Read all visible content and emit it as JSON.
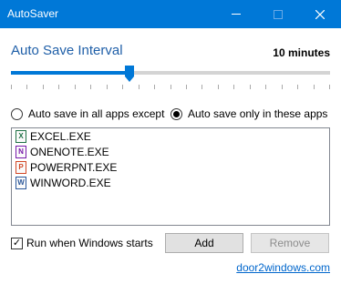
{
  "window": {
    "title": "AutoSaver",
    "minimize_icon": "minimize-icon",
    "maximize_icon": "maximize-icon",
    "close_icon": "close-icon",
    "accent": "#0078d7"
  },
  "interval": {
    "label": "Auto Save Interval",
    "value": "10 minutes",
    "slider_position": 0.37,
    "tick_count": 21
  },
  "mode": {
    "option_all_except": "Auto save in all apps except",
    "option_only_these": "Auto save only in these apps",
    "selected": "only_these"
  },
  "apps": [
    {
      "name": "EXCEL.EXE",
      "icon": "excel-icon",
      "color": "#1e7145",
      "glyph": "X"
    },
    {
      "name": "ONENOTE.EXE",
      "icon": "onenote-icon",
      "color": "#7719aa",
      "glyph": "N"
    },
    {
      "name": "POWERPNT.EXE",
      "icon": "powerpoint-icon",
      "color": "#d24726",
      "glyph": "P"
    },
    {
      "name": "WINWORD.EXE",
      "icon": "word-icon",
      "color": "#2b579a",
      "glyph": "W"
    }
  ],
  "startup": {
    "label": "Run when Windows starts",
    "checked": true
  },
  "buttons": {
    "add": "Add",
    "remove": "Remove"
  },
  "footer": {
    "link": "door2windows.com"
  }
}
